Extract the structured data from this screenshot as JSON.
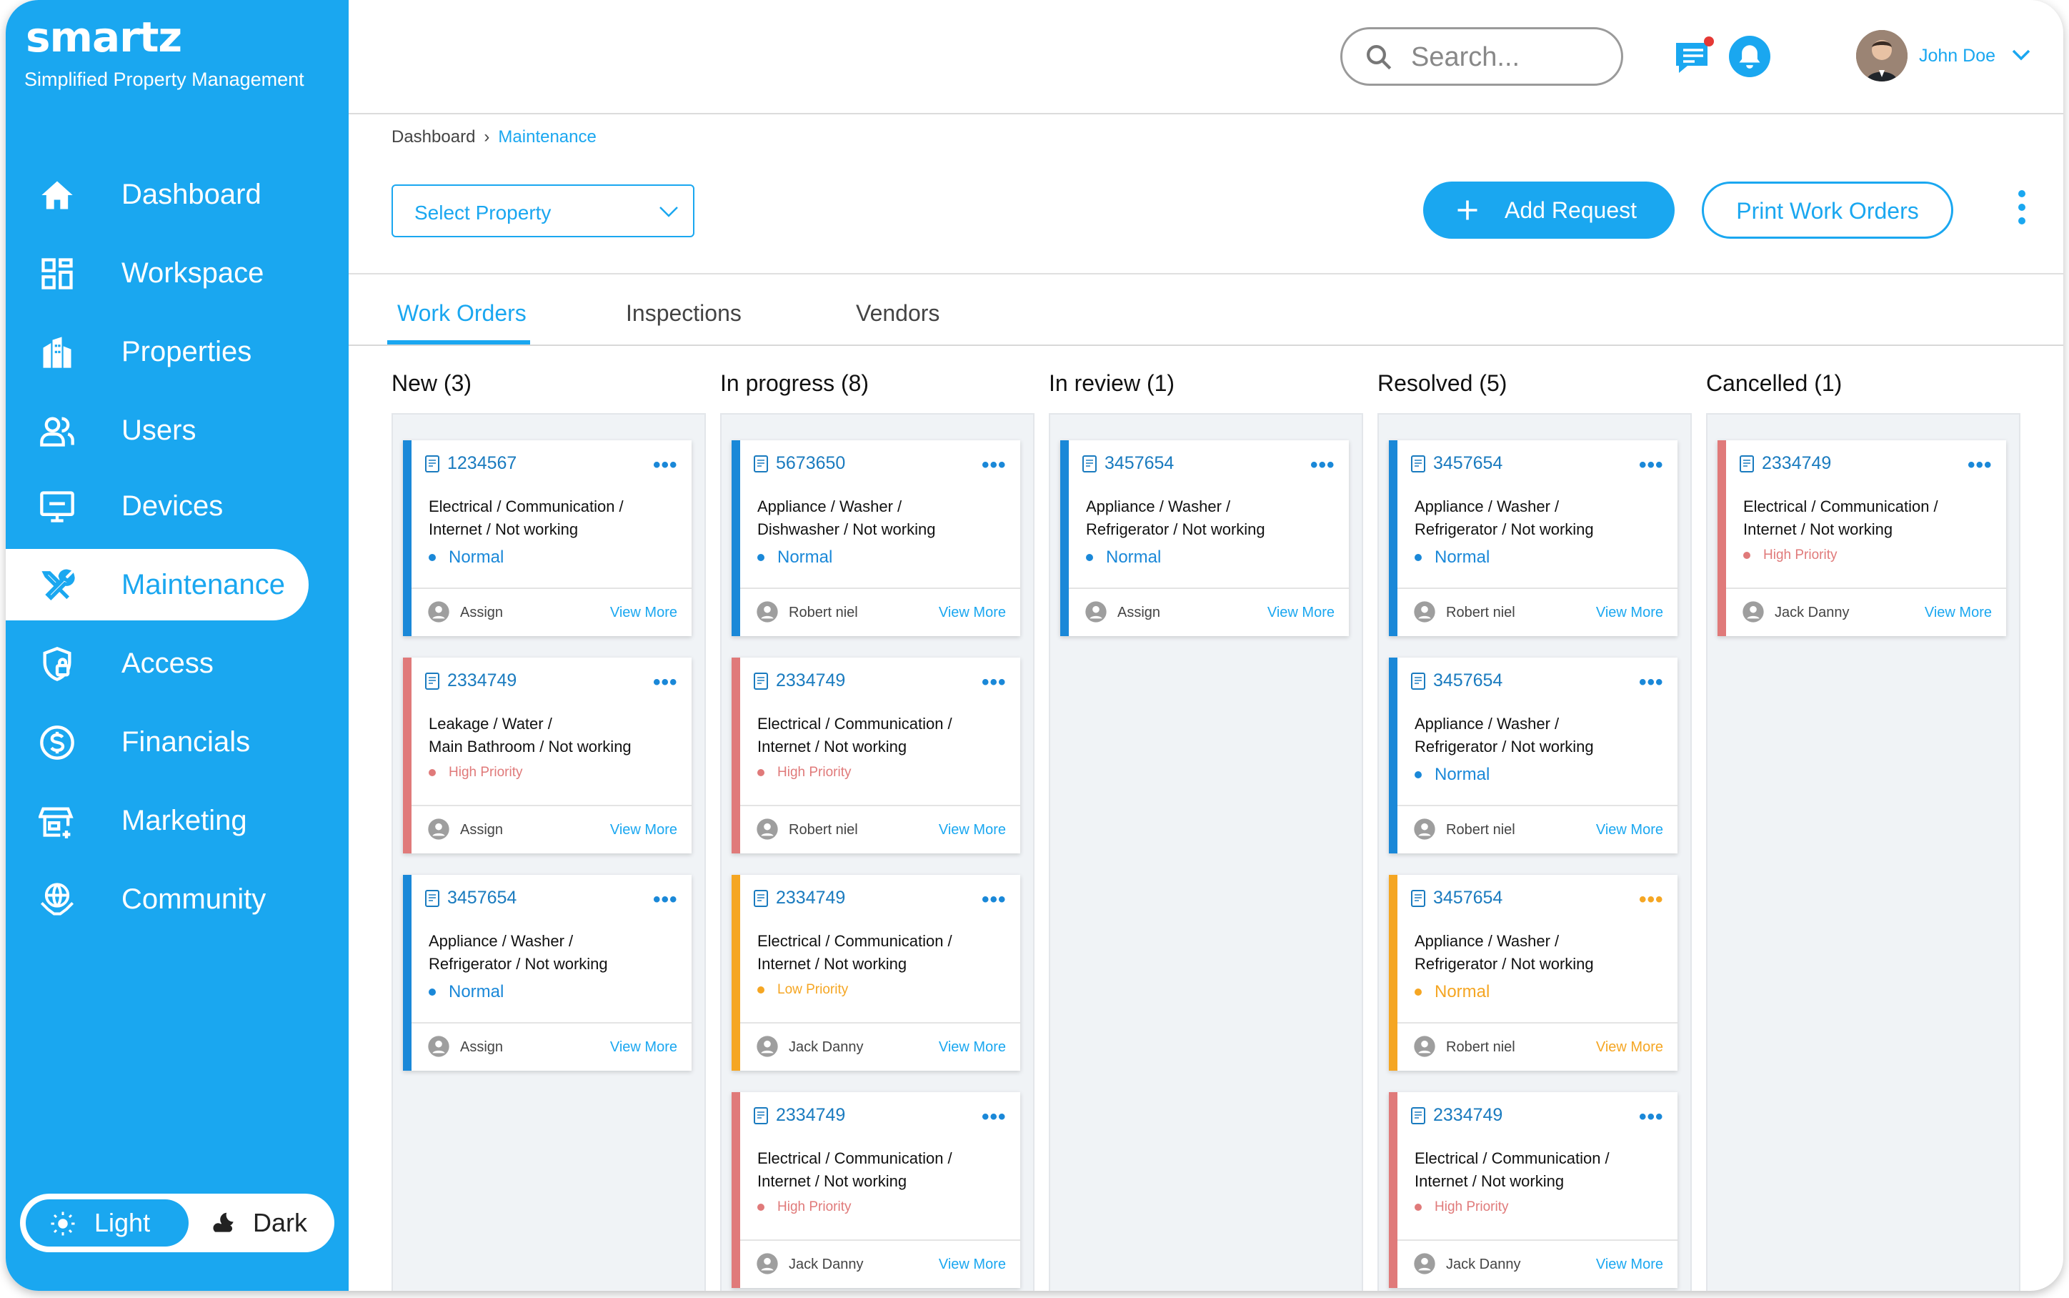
{
  "brand": {
    "logo": "smartz",
    "tagline": "Simplified Property Management"
  },
  "colors": {
    "primary": "#1aa7f0",
    "normal": "#1a88d8",
    "high": "#e07a7a",
    "low": "#f5a623"
  },
  "nav": [
    {
      "label": "Dashboard",
      "icon": "home-icon"
    },
    {
      "label": "Workspace",
      "icon": "grid-icon"
    },
    {
      "label": "Properties",
      "icon": "building-icon"
    },
    {
      "label": "Users",
      "icon": "users-icon"
    },
    {
      "label": "Devices",
      "icon": "monitor-icon"
    },
    {
      "label": "Maintenance",
      "icon": "tools-icon",
      "active": true
    },
    {
      "label": "Access",
      "icon": "shield-lock-icon"
    },
    {
      "label": "Financials",
      "icon": "dollar-icon"
    },
    {
      "label": "Marketing",
      "icon": "storefront-icon"
    },
    {
      "label": "Community",
      "icon": "globe-hands-icon"
    }
  ],
  "theme": {
    "light": "Light",
    "dark": "Dark",
    "selected": "Light"
  },
  "header": {
    "search_placeholder": "Search...",
    "user_name": "John Doe"
  },
  "breadcrumb": {
    "root": "Dashboard",
    "current": "Maintenance"
  },
  "toolbar": {
    "select_property": "Select Property",
    "add_request": "Add Request",
    "print_work_orders": "Print Work Orders"
  },
  "tabs": [
    {
      "label": "Work Orders",
      "active": true
    },
    {
      "label": "Inspections"
    },
    {
      "label": "Vendors"
    }
  ],
  "columns": [
    {
      "title": "New (3)",
      "cards": [
        {
          "id": "1234567",
          "l1": "Electrical / Communication /",
          "l2": "Internet / Not working",
          "priority": "Normal",
          "color": "#1a88d8",
          "who": "Assign",
          "view": "View More"
        },
        {
          "id": "2334749",
          "l1": "Leakage / Water /",
          "l2": "Main Bathroom / Not working",
          "priority": "High Priority",
          "color": "#e07a7a",
          "who": "Assign",
          "view": "View More"
        },
        {
          "id": "3457654",
          "l1": "Appliance / Washer /",
          "l2": "Refrigerator / Not working",
          "priority": "Normal",
          "color": "#1a88d8",
          "who": "Assign",
          "view": "View More"
        }
      ]
    },
    {
      "title": "In progress (8)",
      "cards": [
        {
          "id": "5673650",
          "l1": "Appliance / Washer /",
          "l2": "Dishwasher / Not working",
          "priority": "Normal",
          "color": "#1a88d8",
          "who": "Robert niel",
          "view": "View More"
        },
        {
          "id": "2334749",
          "l1": "Electrical / Communication /",
          "l2": "Internet / Not working",
          "priority": "High Priority",
          "color": "#e07a7a",
          "who": "Robert niel",
          "view": "View More"
        },
        {
          "id": "2334749",
          "l1": "Electrical / Communication /",
          "l2": "Internet / Not working",
          "priority": "Low Priority",
          "color": "#f5a623",
          "who": "Jack Danny",
          "view": "View More"
        },
        {
          "id": "2334749",
          "l1": "Electrical / Communication /",
          "l2": "Internet / Not working",
          "priority": "High Priority",
          "color": "#e07a7a",
          "who": "Jack Danny",
          "view": "View More"
        }
      ]
    },
    {
      "title": "In review (1)",
      "cards": [
        {
          "id": "3457654",
          "l1": "Appliance / Washer /",
          "l2": "Refrigerator / Not working",
          "priority": "Normal",
          "color": "#1a88d8",
          "who": "Assign",
          "view": "View More"
        }
      ]
    },
    {
      "title": "Resolved (5)",
      "cards": [
        {
          "id": "3457654",
          "l1": "Appliance / Washer /",
          "l2": "Refrigerator / Not working",
          "priority": "Normal",
          "color": "#1a88d8",
          "who": "Robert niel",
          "view": "View More"
        },
        {
          "id": "3457654",
          "l1": "Appliance / Washer /",
          "l2": "Refrigerator / Not working",
          "priority": "Normal",
          "color": "#1a88d8",
          "who": "Robert niel",
          "view": "View More"
        },
        {
          "id": "3457654",
          "l1": "Appliance / Washer /",
          "l2": "Refrigerator / Not working",
          "priority": "Normal",
          "color": "#f5a623",
          "who": "Robert niel",
          "view": "View More"
        },
        {
          "id": "2334749",
          "l1": "Electrical / Communication /",
          "l2": "Internet / Not working",
          "priority": "High Priority",
          "color": "#e07a7a",
          "who": "Jack Danny",
          "view": "View More"
        }
      ]
    },
    {
      "title": "Cancelled (1)",
      "cards": [
        {
          "id": "2334749",
          "l1": "Electrical / Communication /",
          "l2": "Internet / Not working",
          "priority": "High Priority",
          "color": "#e07a7a",
          "who": "Jack Danny",
          "view": "View More"
        }
      ]
    }
  ]
}
